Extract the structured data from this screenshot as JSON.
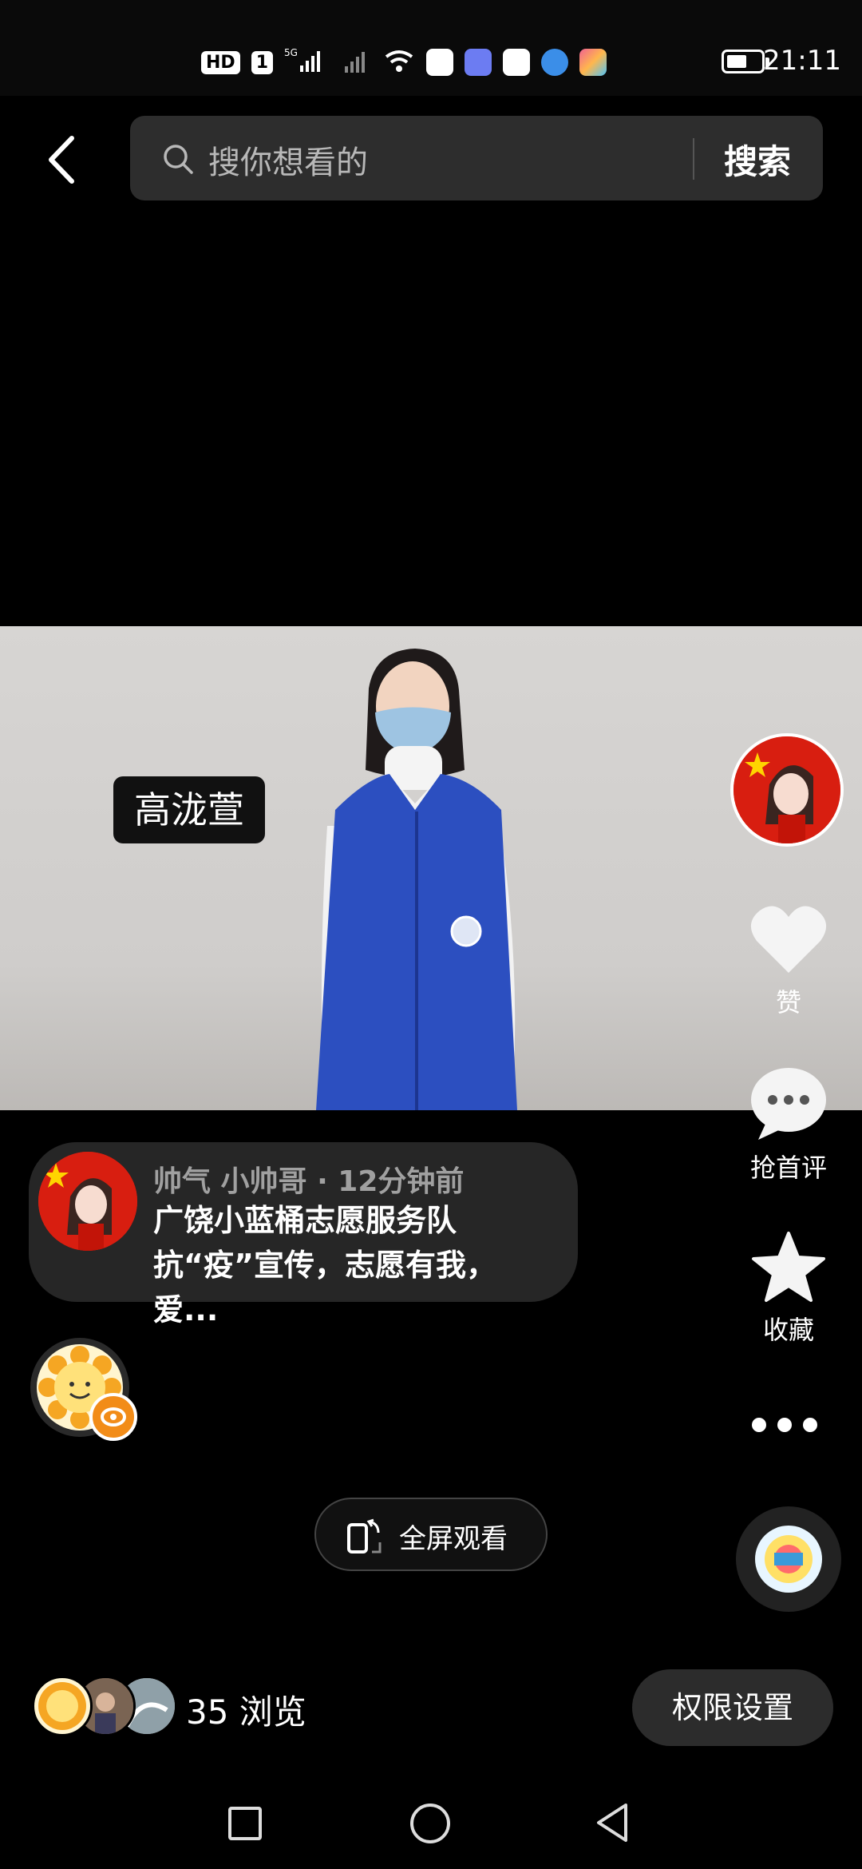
{
  "status_bar": {
    "badges": [
      "HD",
      "1"
    ],
    "network": "5G",
    "time": "21:11",
    "app_icon_colors": [
      "#ffffff",
      "#6c7cf2",
      "#ffffff",
      "#3b8ee8",
      "#f06292"
    ]
  },
  "search": {
    "placeholder": "搜你想看的",
    "button_label": "搜索"
  },
  "video": {
    "name_tag": "高泷萱"
  },
  "rail": {
    "like_label": "赞",
    "comment_label": "抢首评",
    "favorite_label": "收藏"
  },
  "author": {
    "name": "帅气 小帅哥",
    "time": "12分钟前",
    "meta_separator": " · ",
    "description": "广饶小蓝桶志愿服务队抗“疫”宣传，志愿有我，爱..."
  },
  "fullscreen": {
    "label": "全屏观看"
  },
  "viewers": {
    "count_text": "35 浏览"
  },
  "permission": {
    "label": "权限设置"
  },
  "colors": {
    "background": "#000000",
    "card": "#262626",
    "live_badge": "#f28c18",
    "avatar_red": "#d81e10"
  }
}
